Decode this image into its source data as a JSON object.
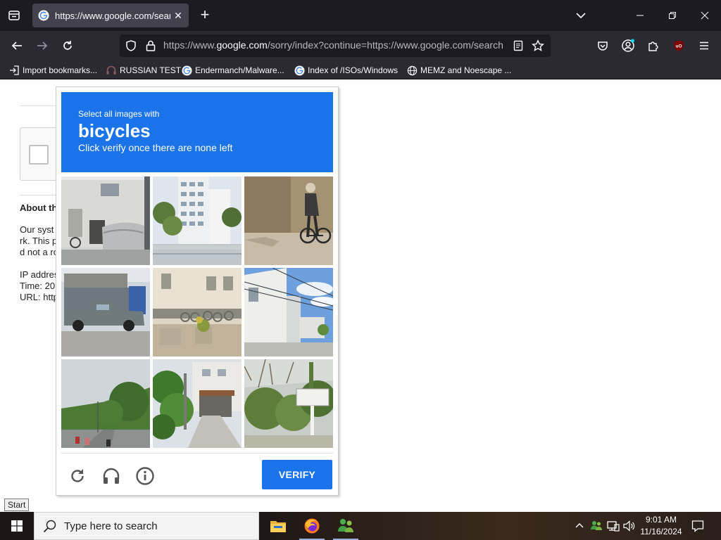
{
  "browser": {
    "tab": {
      "title": "https://www.google.com/search"
    },
    "url": {
      "prefix": "https://www.",
      "domain": "google.com",
      "rest": "/sorry/index?continue=https://www.google.com/search"
    },
    "bookmarks": [
      {
        "label": "Import bookmarks...",
        "icon": "import-icon"
      },
      {
        "label": "RUSSIAN TEST",
        "icon": "headphones-icon"
      },
      {
        "label": "Endermanch/Malware...",
        "icon": "google-icon"
      },
      {
        "label": "Index of /ISOs/Windows",
        "icon": "google-icon"
      },
      {
        "label": "MEMZ and Noescape ...",
        "icon": "globe-icon"
      }
    ]
  },
  "background_page": {
    "lines": [
      "About th",
      "Our syst",
      "rk. This p",
      "d not a ro",
      "IP addres",
      "Time: 20",
      "URL: http"
    ]
  },
  "captcha": {
    "instruction": "Select all images with",
    "object": "bicycles",
    "hint": "Click verify once there are none left",
    "tiles": [
      {
        "scene": "building-with-covered-bike"
      },
      {
        "scene": "apartment-blocks-trees"
      },
      {
        "scene": "person-riding-bicycle"
      },
      {
        "scene": "pickup-truck-storefront"
      },
      {
        "scene": "building-with-bike-rack"
      },
      {
        "scene": "white-house-powerlines"
      },
      {
        "scene": "road-with-motorbikes"
      },
      {
        "scene": "narrow-street-trees"
      },
      {
        "scene": "sign-in-bushes"
      }
    ],
    "reload_icon": "reload-icon",
    "audio_icon": "headphones-icon",
    "info_icon": "info-icon",
    "verify_label": "VERIFY",
    "accent_color": "#1a73e8"
  },
  "taskbar": {
    "start_tooltip": "Start",
    "search_placeholder": "Type here to search",
    "apps": [
      "file-explorer-icon",
      "firefox-icon",
      "messenger-icon"
    ],
    "time": "9:01 AM",
    "date": "11/16/2024"
  }
}
